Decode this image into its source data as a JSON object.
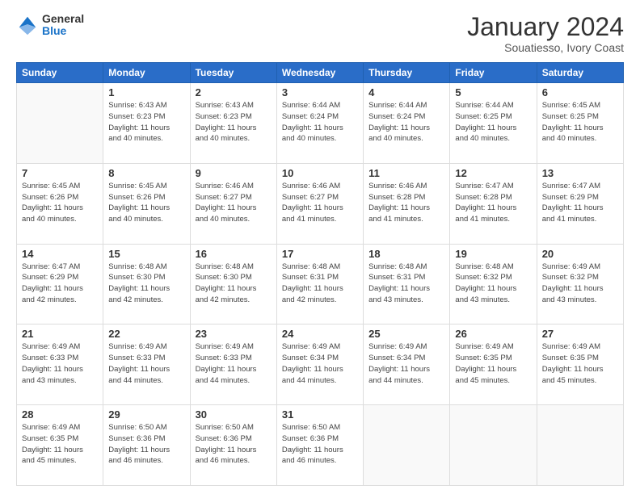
{
  "logo": {
    "general": "General",
    "blue": "Blue"
  },
  "header": {
    "month": "January 2024",
    "location": "Souatiesso, Ivory Coast"
  },
  "days_of_week": [
    "Sunday",
    "Monday",
    "Tuesday",
    "Wednesday",
    "Thursday",
    "Friday",
    "Saturday"
  ],
  "weeks": [
    [
      {
        "day": "",
        "info": ""
      },
      {
        "day": "1",
        "info": "Sunrise: 6:43 AM\nSunset: 6:23 PM\nDaylight: 11 hours\nand 40 minutes."
      },
      {
        "day": "2",
        "info": "Sunrise: 6:43 AM\nSunset: 6:23 PM\nDaylight: 11 hours\nand 40 minutes."
      },
      {
        "day": "3",
        "info": "Sunrise: 6:44 AM\nSunset: 6:24 PM\nDaylight: 11 hours\nand 40 minutes."
      },
      {
        "day": "4",
        "info": "Sunrise: 6:44 AM\nSunset: 6:24 PM\nDaylight: 11 hours\nand 40 minutes."
      },
      {
        "day": "5",
        "info": "Sunrise: 6:44 AM\nSunset: 6:25 PM\nDaylight: 11 hours\nand 40 minutes."
      },
      {
        "day": "6",
        "info": "Sunrise: 6:45 AM\nSunset: 6:25 PM\nDaylight: 11 hours\nand 40 minutes."
      }
    ],
    [
      {
        "day": "7",
        "info": "Sunrise: 6:45 AM\nSunset: 6:26 PM\nDaylight: 11 hours\nand 40 minutes."
      },
      {
        "day": "8",
        "info": "Sunrise: 6:45 AM\nSunset: 6:26 PM\nDaylight: 11 hours\nand 40 minutes."
      },
      {
        "day": "9",
        "info": "Sunrise: 6:46 AM\nSunset: 6:27 PM\nDaylight: 11 hours\nand 40 minutes."
      },
      {
        "day": "10",
        "info": "Sunrise: 6:46 AM\nSunset: 6:27 PM\nDaylight: 11 hours\nand 41 minutes."
      },
      {
        "day": "11",
        "info": "Sunrise: 6:46 AM\nSunset: 6:28 PM\nDaylight: 11 hours\nand 41 minutes."
      },
      {
        "day": "12",
        "info": "Sunrise: 6:47 AM\nSunset: 6:28 PM\nDaylight: 11 hours\nand 41 minutes."
      },
      {
        "day": "13",
        "info": "Sunrise: 6:47 AM\nSunset: 6:29 PM\nDaylight: 11 hours\nand 41 minutes."
      }
    ],
    [
      {
        "day": "14",
        "info": "Sunrise: 6:47 AM\nSunset: 6:29 PM\nDaylight: 11 hours\nand 42 minutes."
      },
      {
        "day": "15",
        "info": "Sunrise: 6:48 AM\nSunset: 6:30 PM\nDaylight: 11 hours\nand 42 minutes."
      },
      {
        "day": "16",
        "info": "Sunrise: 6:48 AM\nSunset: 6:30 PM\nDaylight: 11 hours\nand 42 minutes."
      },
      {
        "day": "17",
        "info": "Sunrise: 6:48 AM\nSunset: 6:31 PM\nDaylight: 11 hours\nand 42 minutes."
      },
      {
        "day": "18",
        "info": "Sunrise: 6:48 AM\nSunset: 6:31 PM\nDaylight: 11 hours\nand 43 minutes."
      },
      {
        "day": "19",
        "info": "Sunrise: 6:48 AM\nSunset: 6:32 PM\nDaylight: 11 hours\nand 43 minutes."
      },
      {
        "day": "20",
        "info": "Sunrise: 6:49 AM\nSunset: 6:32 PM\nDaylight: 11 hours\nand 43 minutes."
      }
    ],
    [
      {
        "day": "21",
        "info": "Sunrise: 6:49 AM\nSunset: 6:33 PM\nDaylight: 11 hours\nand 43 minutes."
      },
      {
        "day": "22",
        "info": "Sunrise: 6:49 AM\nSunset: 6:33 PM\nDaylight: 11 hours\nand 44 minutes."
      },
      {
        "day": "23",
        "info": "Sunrise: 6:49 AM\nSunset: 6:33 PM\nDaylight: 11 hours\nand 44 minutes."
      },
      {
        "day": "24",
        "info": "Sunrise: 6:49 AM\nSunset: 6:34 PM\nDaylight: 11 hours\nand 44 minutes."
      },
      {
        "day": "25",
        "info": "Sunrise: 6:49 AM\nSunset: 6:34 PM\nDaylight: 11 hours\nand 44 minutes."
      },
      {
        "day": "26",
        "info": "Sunrise: 6:49 AM\nSunset: 6:35 PM\nDaylight: 11 hours\nand 45 minutes."
      },
      {
        "day": "27",
        "info": "Sunrise: 6:49 AM\nSunset: 6:35 PM\nDaylight: 11 hours\nand 45 minutes."
      }
    ],
    [
      {
        "day": "28",
        "info": "Sunrise: 6:49 AM\nSunset: 6:35 PM\nDaylight: 11 hours\nand 45 minutes."
      },
      {
        "day": "29",
        "info": "Sunrise: 6:50 AM\nSunset: 6:36 PM\nDaylight: 11 hours\nand 46 minutes."
      },
      {
        "day": "30",
        "info": "Sunrise: 6:50 AM\nSunset: 6:36 PM\nDaylight: 11 hours\nand 46 minutes."
      },
      {
        "day": "31",
        "info": "Sunrise: 6:50 AM\nSunset: 6:36 PM\nDaylight: 11 hours\nand 46 minutes."
      },
      {
        "day": "",
        "info": ""
      },
      {
        "day": "",
        "info": ""
      },
      {
        "day": "",
        "info": ""
      }
    ]
  ]
}
